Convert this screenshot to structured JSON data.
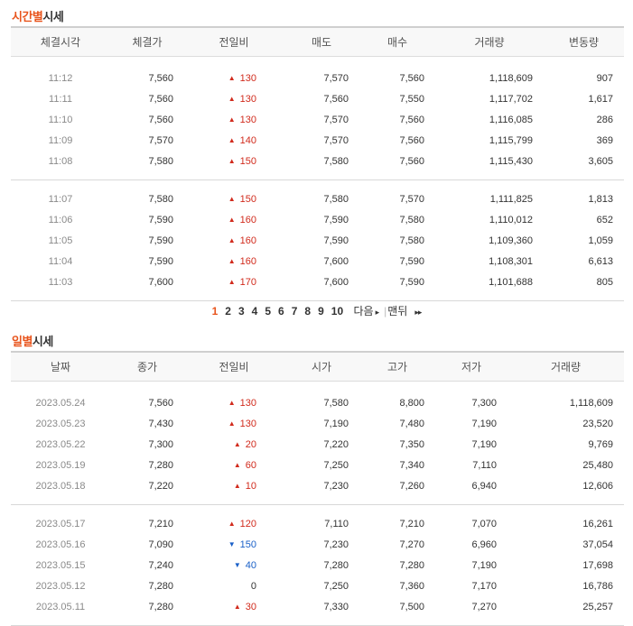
{
  "hourly": {
    "title_highlight": "시간별",
    "title_rest": "시세",
    "headers": [
      "체결시각",
      "체결가",
      "전일비",
      "매도",
      "매수",
      "거래량",
      "변동량"
    ],
    "groups": [
      [
        {
          "time": "11:12",
          "price": "7,560",
          "dir": "up",
          "change": "130",
          "sell": "7,570",
          "buy": "7,560",
          "volume": "1,118,609",
          "delta": "907"
        },
        {
          "time": "11:11",
          "price": "7,560",
          "dir": "up",
          "change": "130",
          "sell": "7,560",
          "buy": "7,550",
          "volume": "1,117,702",
          "delta": "1,617"
        },
        {
          "time": "11:10",
          "price": "7,560",
          "dir": "up",
          "change": "130",
          "sell": "7,570",
          "buy": "7,560",
          "volume": "1,116,085",
          "delta": "286"
        },
        {
          "time": "11:09",
          "price": "7,570",
          "dir": "up",
          "change": "140",
          "sell": "7,570",
          "buy": "7,560",
          "volume": "1,115,799",
          "delta": "369"
        },
        {
          "time": "11:08",
          "price": "7,580",
          "dir": "up",
          "change": "150",
          "sell": "7,580",
          "buy": "7,560",
          "volume": "1,115,430",
          "delta": "3,605"
        }
      ],
      [
        {
          "time": "11:07",
          "price": "7,580",
          "dir": "up",
          "change": "150",
          "sell": "7,580",
          "buy": "7,570",
          "volume": "1,111,825",
          "delta": "1,813"
        },
        {
          "time": "11:06",
          "price": "7,590",
          "dir": "up",
          "change": "160",
          "sell": "7,590",
          "buy": "7,580",
          "volume": "1,110,012",
          "delta": "652"
        },
        {
          "time": "11:05",
          "price": "7,590",
          "dir": "up",
          "change": "160",
          "sell": "7,590",
          "buy": "7,580",
          "volume": "1,109,360",
          "delta": "1,059"
        },
        {
          "time": "11:04",
          "price": "7,590",
          "dir": "up",
          "change": "160",
          "sell": "7,600",
          "buy": "7,590",
          "volume": "1,108,301",
          "delta": "6,613"
        },
        {
          "time": "11:03",
          "price": "7,600",
          "dir": "up",
          "change": "170",
          "sell": "7,600",
          "buy": "7,590",
          "volume": "1,101,688",
          "delta": "805"
        }
      ]
    ]
  },
  "pagination": {
    "pages": [
      "1",
      "2",
      "3",
      "4",
      "5",
      "6",
      "7",
      "8",
      "9",
      "10"
    ],
    "current": "1",
    "next_label": "다음",
    "last_label": "맨뒤",
    "next_icon": "▸",
    "last_icon": "▸▸"
  },
  "daily": {
    "title_highlight": "일별",
    "title_rest": "시세",
    "headers": [
      "날짜",
      "종가",
      "전일비",
      "시가",
      "고가",
      "저가",
      "거래량"
    ],
    "groups": [
      [
        {
          "date": "2023.05.24",
          "close": "7,560",
          "dir": "up",
          "change": "130",
          "open": "7,580",
          "high": "8,800",
          "low": "7,300",
          "volume": "1,118,609"
        },
        {
          "date": "2023.05.23",
          "close": "7,430",
          "dir": "up",
          "change": "130",
          "open": "7,190",
          "high": "7,480",
          "low": "7,190",
          "volume": "23,520"
        },
        {
          "date": "2023.05.22",
          "close": "7,300",
          "dir": "up",
          "change": "20",
          "open": "7,220",
          "high": "7,350",
          "low": "7,190",
          "volume": "9,769"
        },
        {
          "date": "2023.05.19",
          "close": "7,280",
          "dir": "up",
          "change": "60",
          "open": "7,250",
          "high": "7,340",
          "low": "7,110",
          "volume": "25,480"
        },
        {
          "date": "2023.05.18",
          "close": "7,220",
          "dir": "up",
          "change": "10",
          "open": "7,230",
          "high": "7,260",
          "low": "6,940",
          "volume": "12,606"
        }
      ],
      [
        {
          "date": "2023.05.17",
          "close": "7,210",
          "dir": "up",
          "change": "120",
          "open": "7,110",
          "high": "7,210",
          "low": "7,070",
          "volume": "16,261"
        },
        {
          "date": "2023.05.16",
          "close": "7,090",
          "dir": "down",
          "change": "150",
          "open": "7,230",
          "high": "7,270",
          "low": "6,960",
          "volume": "37,054"
        },
        {
          "date": "2023.05.15",
          "close": "7,240",
          "dir": "down",
          "change": "40",
          "open": "7,280",
          "high": "7,280",
          "low": "7,190",
          "volume": "17,698"
        },
        {
          "date": "2023.05.12",
          "close": "7,280",
          "dir": "flat",
          "change": "0",
          "open": "7,250",
          "high": "7,360",
          "low": "7,170",
          "volume": "16,786"
        },
        {
          "date": "2023.05.11",
          "close": "7,280",
          "dir": "up",
          "change": "30",
          "open": "7,330",
          "high": "7,500",
          "low": "7,270",
          "volume": "25,257"
        }
      ]
    ]
  },
  "colors": {
    "accent": "#e8541c",
    "up": "#d12a1c",
    "down": "#1a60c8"
  },
  "icons": {
    "up": "up-triangle-icon",
    "down": "down-triangle-icon"
  }
}
